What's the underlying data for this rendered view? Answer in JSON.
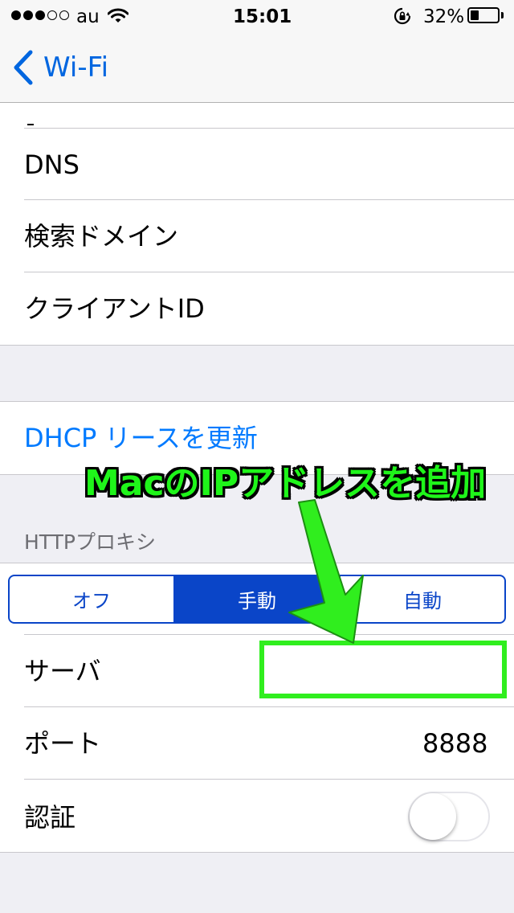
{
  "status_bar": {
    "carrier": "au",
    "time": "15:01",
    "battery_percent": "32%",
    "battery_level": 0.32,
    "signal_bars_filled": 3,
    "signal_bars_total": 5
  },
  "nav": {
    "back_label": "Wi-Fi",
    "accent_color": "#0066e0"
  },
  "dns_group": {
    "rows": [
      "DNS",
      "検索ドメイン",
      "クライアントID"
    ]
  },
  "dhcp": {
    "renew_label": "DHCP リースを更新"
  },
  "proxy": {
    "section_header": "HTTPプロキシ",
    "segments": [
      "オフ",
      "手動",
      "自動"
    ],
    "selected_segment": "手動",
    "server_label": "サーバ",
    "server_value": "",
    "port_label": "ポート",
    "port_value": "8888",
    "auth_label": "認証",
    "auth_enabled": false
  },
  "annotation": {
    "text": "MacのIPアドレスを追加",
    "color": "#30ee1e"
  }
}
